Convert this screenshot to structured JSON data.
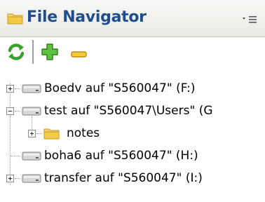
{
  "header": {
    "title": "File Navigator",
    "menu_glyph": "▾≡"
  },
  "toolbar": {
    "refresh_icon": "refresh-icon",
    "add_icon": "add-icon",
    "remove_icon": "remove-icon"
  },
  "tree": {
    "nodes": [
      {
        "label": "Boedv auf \"S560047\" (F:)",
        "expander": "plus",
        "icon": "drive"
      },
      {
        "label": "test auf \"S560047\\Users\" (G",
        "expander": "minus",
        "icon": "drive"
      },
      {
        "label": "notes",
        "expander": "plus",
        "icon": "folder"
      },
      {
        "label": "boha6 auf \"S560047\" (H:)",
        "expander": "none",
        "icon": "drive"
      },
      {
        "label": "transfer auf \"S560047\" (I:)",
        "expander": "plus",
        "icon": "drive"
      }
    ]
  },
  "colors": {
    "title": "#1f4e8a",
    "refresh_green": "#3aa02c",
    "add_green": "#3c9a2a",
    "remove_yellow": "#e7b416",
    "folder_yellow": "#f3c94a"
  }
}
